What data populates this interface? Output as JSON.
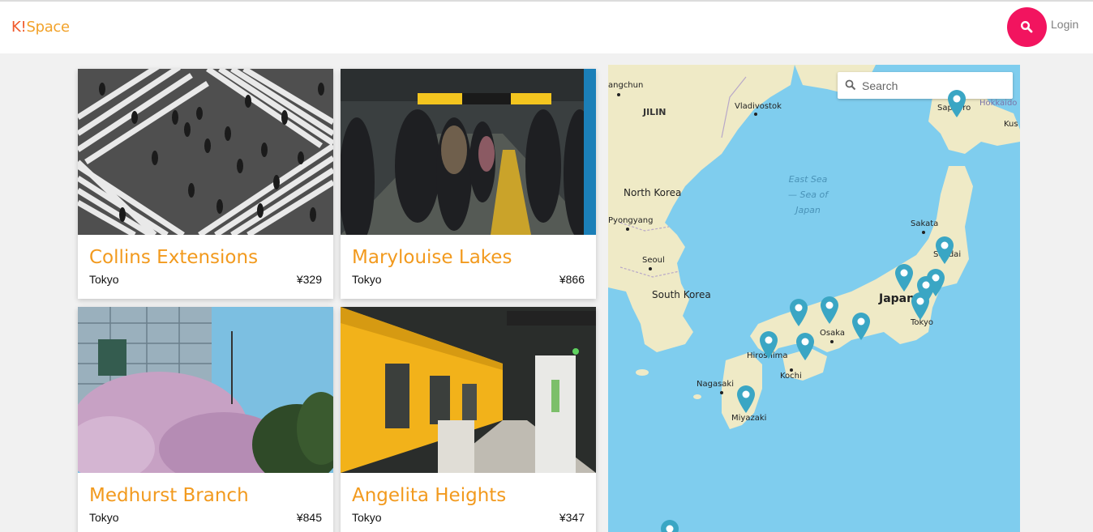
{
  "header": {
    "logo_prefix": "K",
    "logo_mark": "!",
    "logo_suffix": "Space",
    "search_icon": "search-icon",
    "login_label": "Login",
    "accent_color": "#f2145f",
    "brand_color": "#f2a22a"
  },
  "listings": [
    {
      "title": "Collins Extensions",
      "city": "Tokyo",
      "price": "¥329"
    },
    {
      "title": "Marylouise Lakes",
      "city": "Tokyo",
      "price": "¥866"
    },
    {
      "title": "Medhurst Branch",
      "city": "Tokyo",
      "price": "¥845"
    },
    {
      "title": "Angelita Heights",
      "city": "Tokyo",
      "price": "¥347"
    }
  ],
  "map": {
    "search_placeholder": "Search",
    "labels": {
      "changchun": "angchun",
      "jilin": "JILIN",
      "vladivostok": "Vladivostok",
      "sapporo": "Sapporo",
      "hokkaido": "Hokkaido",
      "kushiro": "Kus",
      "east_sea": "East Sea",
      "sea_of": "— Sea of",
      "japan_sea": "Japan",
      "north_korea": "North Korea",
      "pyongyang": "Pyongyang",
      "sakata": "Sakata",
      "sendai": "Sendai",
      "seoul": "Seoul",
      "south_korea": "South Korea",
      "japan": "Japan",
      "osaka": "Osaka",
      "tokyo": "Tokyo",
      "hiroshima": "Hiroshima",
      "kochi": "Kochi",
      "nagasaki": "Nagasaki",
      "miyazaki": "Miyazaki"
    },
    "pin_color": "#3aa6c4",
    "water_color": "#7fcdee",
    "land_color": "#efeac6"
  }
}
